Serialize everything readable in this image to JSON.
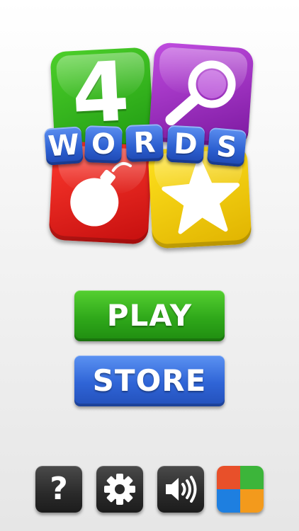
{
  "logo": {
    "number": "4",
    "letters": [
      "W",
      "O",
      "R",
      "D",
      "S"
    ],
    "tile_icons": [
      "magnifier-icon",
      "bomb-icon",
      "star-icon"
    ]
  },
  "buttons": {
    "play": "PLAY",
    "store": "STORE"
  },
  "toolbar": {
    "help": "?",
    "icons": [
      "help-icon",
      "gear-icon",
      "sound-icon",
      "more-games-icon"
    ]
  },
  "colors": {
    "green": "#2fa81a",
    "blue": "#2f64d6",
    "purple": "#9b2ac2",
    "red": "#e01a14",
    "yellow": "#f2c400",
    "more_games_tiles": [
      "#e8502a",
      "#3cb53a",
      "#1e7fe0",
      "#f39a1c"
    ]
  }
}
